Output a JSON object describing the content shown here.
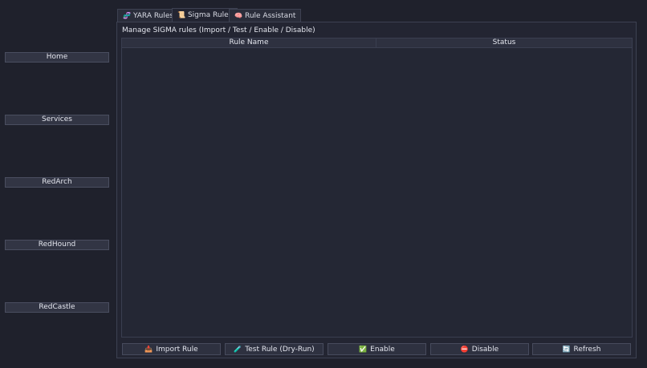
{
  "sidebar": {
    "items": [
      {
        "label": "Home"
      },
      {
        "label": "Services"
      },
      {
        "label": "RedArch"
      },
      {
        "label": "RedHound"
      },
      {
        "label": "RedCastle"
      }
    ]
  },
  "tabs": [
    {
      "label": "YARA Rules",
      "icon": "🧬",
      "icon_name": "dna-icon"
    },
    {
      "label": "Sigma Rules",
      "icon": "📜",
      "icon_name": "scroll-icon",
      "active": true
    },
    {
      "label": "Rule Assistant",
      "icon": "🧠",
      "icon_name": "brain-icon"
    }
  ],
  "pane": {
    "description": "Manage SIGMA rules (Import / Test / Enable / Disable)",
    "table": {
      "columns": [
        "Rule Name",
        "Status"
      ],
      "rows": []
    }
  },
  "actions": [
    {
      "label": "Import Rule",
      "icon": "📥",
      "icon_name": "inbox-tray-icon"
    },
    {
      "label": "Test Rule (Dry-Run)",
      "icon": "🧪",
      "icon_name": "test-tube-icon"
    },
    {
      "label": "Enable",
      "icon": "✅",
      "icon_name": "check-icon"
    },
    {
      "label": "Disable",
      "icon": "⛔",
      "icon_name": "no-entry-icon"
    },
    {
      "label": "Refresh",
      "icon": "🔄",
      "icon_name": "refresh-icon"
    }
  ],
  "colors": {
    "background": "#1f212c",
    "panel": "#232532",
    "button": "#2e3140",
    "border": "#3d4152",
    "text": "#e4e6ee"
  }
}
